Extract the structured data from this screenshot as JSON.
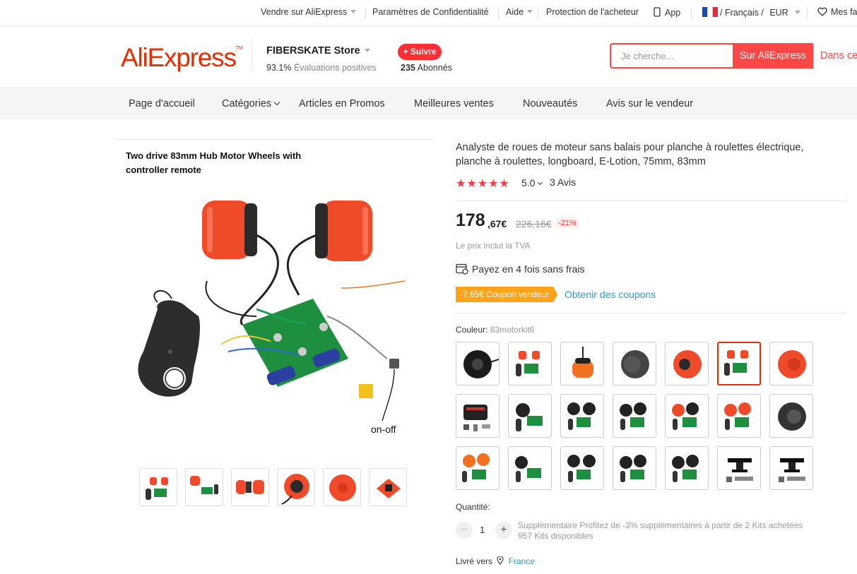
{
  "topbar": {
    "sell": "Vendre sur AliExpress",
    "privacy": "Paramètres de Confidentialité",
    "help": "Aide",
    "buyer_protection": "Protection de l'acheteur",
    "app": "App",
    "language": "/ Français /",
    "currency": "EUR",
    "wishlist": "Mes fa"
  },
  "header": {
    "logo": "AliExpress",
    "store_name": "FIBERSKATE Store",
    "positive_pct": "93.1%",
    "positive_label": "Évaluations positives",
    "follow": "+ Suivre",
    "followers_count": "235",
    "followers_label": "Abonnés",
    "search_placeholder": "Je cherche...",
    "search_ali": "Sur AliExpress",
    "search_store": "Dans ce"
  },
  "nav": [
    "Page d'accueil",
    "Catégories",
    "Articles en Promos",
    "Meilleures ventes",
    "Nouveautés",
    "Avis sur le vendeur"
  ],
  "gallery": {
    "caption": "Two drive 83mm Hub Motor Wheels with controller remote",
    "onoff": "on-off"
  },
  "product": {
    "title": "Analyste de roues de moteur sans balais pour planche à roulettes électrique, planche à roulettes, longboard, E-Lotion, 75mm, 83mm",
    "stars": "★★★★★",
    "rating": "5.0",
    "reviews": "3 Avis",
    "price_int": "178",
    "price_dec": ",67€",
    "price_old": "226,16€",
    "discount": "-21%",
    "tva": "Le prix inclut la TVA",
    "installments": "Payez en 4 fois sans frais",
    "coupon": "-7,65€ Coupon vendeur",
    "coupon_link": "Obtenir des coupons",
    "color_label": "Couleur:",
    "color_value": "83motorkit6",
    "qty_label": "Quantité:",
    "qty_value": "1",
    "qty_minus": "−",
    "qty_plus": "+",
    "extra_discount": "Supplémentaire Profitez de -3% supplémentaires à partir de 2 Kits achetées",
    "stock": "957 Kits disponibles",
    "ship_label": "Livré vers",
    "ship_country": "France"
  },
  "colors": {
    "brand": "#e62e04",
    "accent": "#ff4747",
    "coupon": "#ffa31a",
    "link": "#2e9cc3"
  }
}
